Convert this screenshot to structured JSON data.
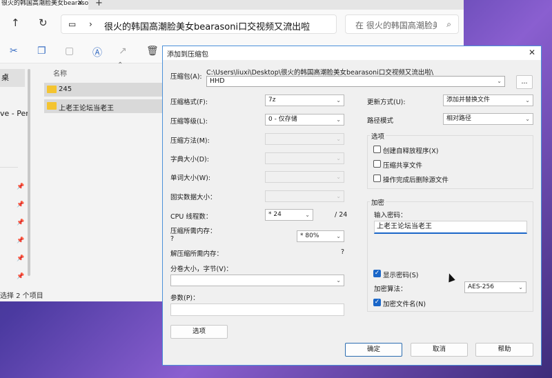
{
  "explorer": {
    "tab_title": "很火的韩国高潮脸美女bearasoni",
    "tab_close": "✕",
    "new_tab": "+",
    "address": "很火的韩国高潮脸美女bearasoni口交视频又流出啦",
    "search_placeholder": "在 很火的韩国高潮脸美女",
    "column_name": "名称",
    "files": [
      {
        "name": "245"
      },
      {
        "name": "上老王论坛当老王"
      }
    ],
    "sidebar_selected": "桌",
    "sidebar_text": "ve - Per",
    "status": "选择 2 个项目"
  },
  "dialog": {
    "title": "添加到压缩包",
    "archive_label": "压缩包(A):",
    "archive_path": "C:\\Users\\liuxi\\Desktop\\很火的韩国高潮脸美女bearasoni口交视频又流出啦\\",
    "archive_name": "HHD",
    "browse_btn": "...",
    "format_label": "压缩格式(F):",
    "format_value": "7z",
    "level_label": "压缩等级(L):",
    "level_value": "0 - 仅存储",
    "method_label": "压缩方法(M):",
    "dict_label": "字典大小(D):",
    "word_label": "单词大小(W):",
    "solid_label": "固实数据大小：",
    "cpu_label": "CPU 线程数：",
    "cpu_value": "* 24",
    "cpu_total": "/ 24",
    "mem_compress_label": "压缩所需内存：",
    "mem_compress_q": "?",
    "mem_compress_value": "* 80%",
    "mem_decompress_label": "解压缩所需内存：",
    "mem_decompress_q": "?",
    "split_label": "分卷大小，字节(V)：",
    "params_label": "参数(P)：",
    "options_btn": "选项",
    "update_label": "更新方式(U):",
    "update_value": "添加并替换文件",
    "pathmode_label": "路径模式",
    "pathmode_value": "相对路径",
    "options_group": "选项",
    "opt_sfx": "创建自释放程序(X)",
    "opt_shared": "压缩共享文件",
    "opt_delete": "操作完成后删除源文件",
    "encrypt_group": "加密",
    "enter_pwd_label": "输入密码：",
    "pwd_value": "上老王论坛当老王",
    "show_pwd": "显示密码(S)",
    "enc_method_label": "加密算法：",
    "enc_method_value": "AES-256",
    "encrypt_names": "加密文件名(N)",
    "ok_btn": "确定",
    "cancel_btn": "取消",
    "help_btn": "帮助",
    "close": "✕"
  }
}
